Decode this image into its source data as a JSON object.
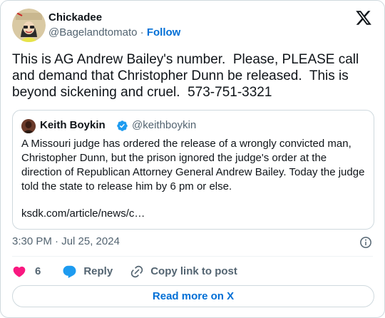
{
  "tweet": {
    "author": {
      "name": "Chickadee",
      "handle": "@Bagelandtomato",
      "separator": "·",
      "follow_label": "Follow",
      "avatar_icon": "cartoon-avatar-icon"
    },
    "brand_icon": "x-logo-icon",
    "text": "This is AG Andrew Bailey's number.  Please, PLEASE call and demand that Christopher Dunn be released.  This is beyond sickening and cruel.  573-751-3321",
    "quoted": {
      "author_name": "Keith Boykin",
      "verified_icon": "verified-badge-icon",
      "handle": "@keithboykin",
      "text": "A Missouri judge has ordered the release of a wrongly convicted man, Christopher Dunn, but the prison ignored the judge's order at the direction of Republican Attorney General Andrew Bailey. Today the judge told the state to release him by 6 pm or else.",
      "link": "ksdk.com/article/news/c…"
    },
    "timestamp": "3:30 PM · Jul 25, 2024",
    "info_icon": "info-icon",
    "actions": {
      "like_count": "6",
      "reply_label": "Reply",
      "copy_label": "Copy link to post"
    },
    "read_more_label": "Read more on X"
  },
  "colors": {
    "accent": "#006fd6",
    "like": "#f91880",
    "reply": "#1d9bf0",
    "muted_text": "#536471",
    "border": "#cfd9de"
  }
}
